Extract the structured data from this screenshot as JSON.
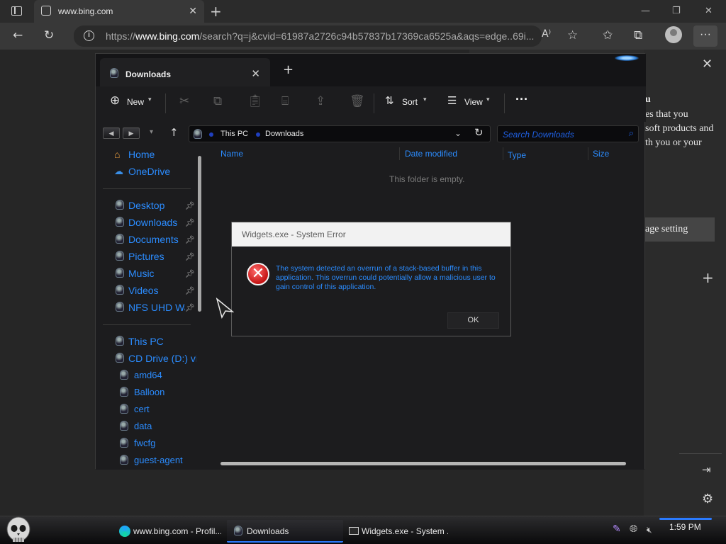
{
  "browser": {
    "tab_title": "www.bing.com",
    "url_prefix": "https://",
    "url_domain": "www.bing.com",
    "url_rest": "/search?q=j&cvid=61987a2726c94b57837b17369ca6525a&aqs=edge..69i..."
  },
  "page": {
    "panel_lines": [
      "u",
      "es that you",
      "soft products and",
      "th you or your"
    ],
    "panel_button": "age setting"
  },
  "explorer": {
    "tab_title": "Downloads",
    "commands": {
      "new": "New",
      "sort": "Sort",
      "view": "View"
    },
    "breadcrumb": [
      "This PC",
      "Downloads"
    ],
    "search_placeholder": "Search Downloads",
    "nav": {
      "home": "Home",
      "onedrive": "OneDrive",
      "desktop": "Desktop",
      "downloads": "Downloads",
      "documents": "Documents",
      "pictures": "Pictures",
      "music": "Music",
      "videos": "Videos",
      "nfs": "NFS UHD Wa",
      "thispc": "This PC",
      "cddrive": "CD Drive (D:) virt",
      "sub": [
        "amd64",
        "Balloon",
        "cert",
        "data",
        "fwcfg",
        "guest-agent"
      ]
    },
    "columns": {
      "name": "Name",
      "date": "Date modified",
      "type": "Type",
      "size": "Size"
    },
    "empty_message": "This folder is empty."
  },
  "dialog": {
    "title": "Widgets.exe - System Error",
    "message": "The system detected an overrun of a stack-based buffer in this application. This overrun could potentially allow a malicious user to gain control of this application.",
    "ok": "OK"
  },
  "taskbar": {
    "items": [
      "www.bing.com - Profil...",
      "Downloads",
      "Widgets.exe - System ..."
    ],
    "time": "1:59 PM"
  },
  "colors": {
    "accent": "#2b8cff",
    "error": "#c41414"
  },
  "icons": [
    "search-icon",
    "refresh-icon",
    "back-icon",
    "up-arrow-icon",
    "close-icon",
    "pin-icon",
    "error-icon",
    "settings-icon"
  ]
}
